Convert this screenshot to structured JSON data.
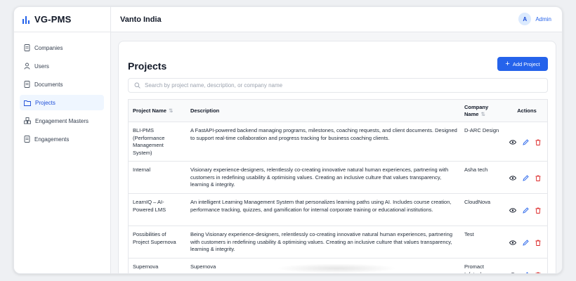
{
  "app": {
    "brand": "VG-PMS"
  },
  "header": {
    "org": "Vanto India",
    "user_initial": "A",
    "user_name": "Admin"
  },
  "sidebar": {
    "items": [
      {
        "label": "Companies",
        "icon": "document-icon",
        "active": false
      },
      {
        "label": "Users",
        "icon": "user-icon",
        "active": false
      },
      {
        "label": "Documents",
        "icon": "document-icon",
        "active": false
      },
      {
        "label": "Projects",
        "icon": "folder-icon",
        "active": true
      },
      {
        "label": "Engagement Masters",
        "icon": "cubes-icon",
        "active": false
      },
      {
        "label": "Engagements",
        "icon": "document-icon",
        "active": false
      }
    ]
  },
  "page": {
    "title": "Projects",
    "add_button": "Add Project",
    "search_placeholder": "Search by project name, description, or company name"
  },
  "table": {
    "headers": {
      "name": "Project Name",
      "description": "Description",
      "company_line1": "Company",
      "company_line2": "Name",
      "actions": "Actions"
    },
    "rows": [
      {
        "name": "BLI-PMS (Performance Management System)",
        "description": "A FastAPI-powered backend managing programs, milestones, coaching requests, and client documents. Designed to support real-time collaboration and progress tracking for business coaching clients.",
        "company": "D-ARC Design"
      },
      {
        "name": "Internal",
        "description": "Visionary experience-designers, relentlessly co-creating innovative natural human experiences, partnering with customers in redefining usability & optimising values. Creating an inclusive culture that values transparency, learning & integrity.",
        "company": "Asha tech"
      },
      {
        "name": "LearnIQ – AI-Powered LMS",
        "description": "An intelligent Learning Management System that personalizes learning paths using AI. Includes course creation, performance tracking, quizzes, and gamification for internal corporate training or educational institutions.",
        "company": "CloudNova"
      },
      {
        "name": "Possibilities of Project Supernova",
        "description": "Being Visionary experience-designers, relentlessly co-creating innovative natural human experiences, partnering with customers in redefining usability & optimising values. Creating an inclusive culture that values transparency, learning & integrity.",
        "company": "Test"
      },
      {
        "name": "Supernova",
        "description": "Supernova",
        "company": "Promact Infotech"
      }
    ]
  },
  "colors": {
    "accent": "#2563eb",
    "danger": "#dc2626",
    "active_bg": "#eff6ff"
  }
}
